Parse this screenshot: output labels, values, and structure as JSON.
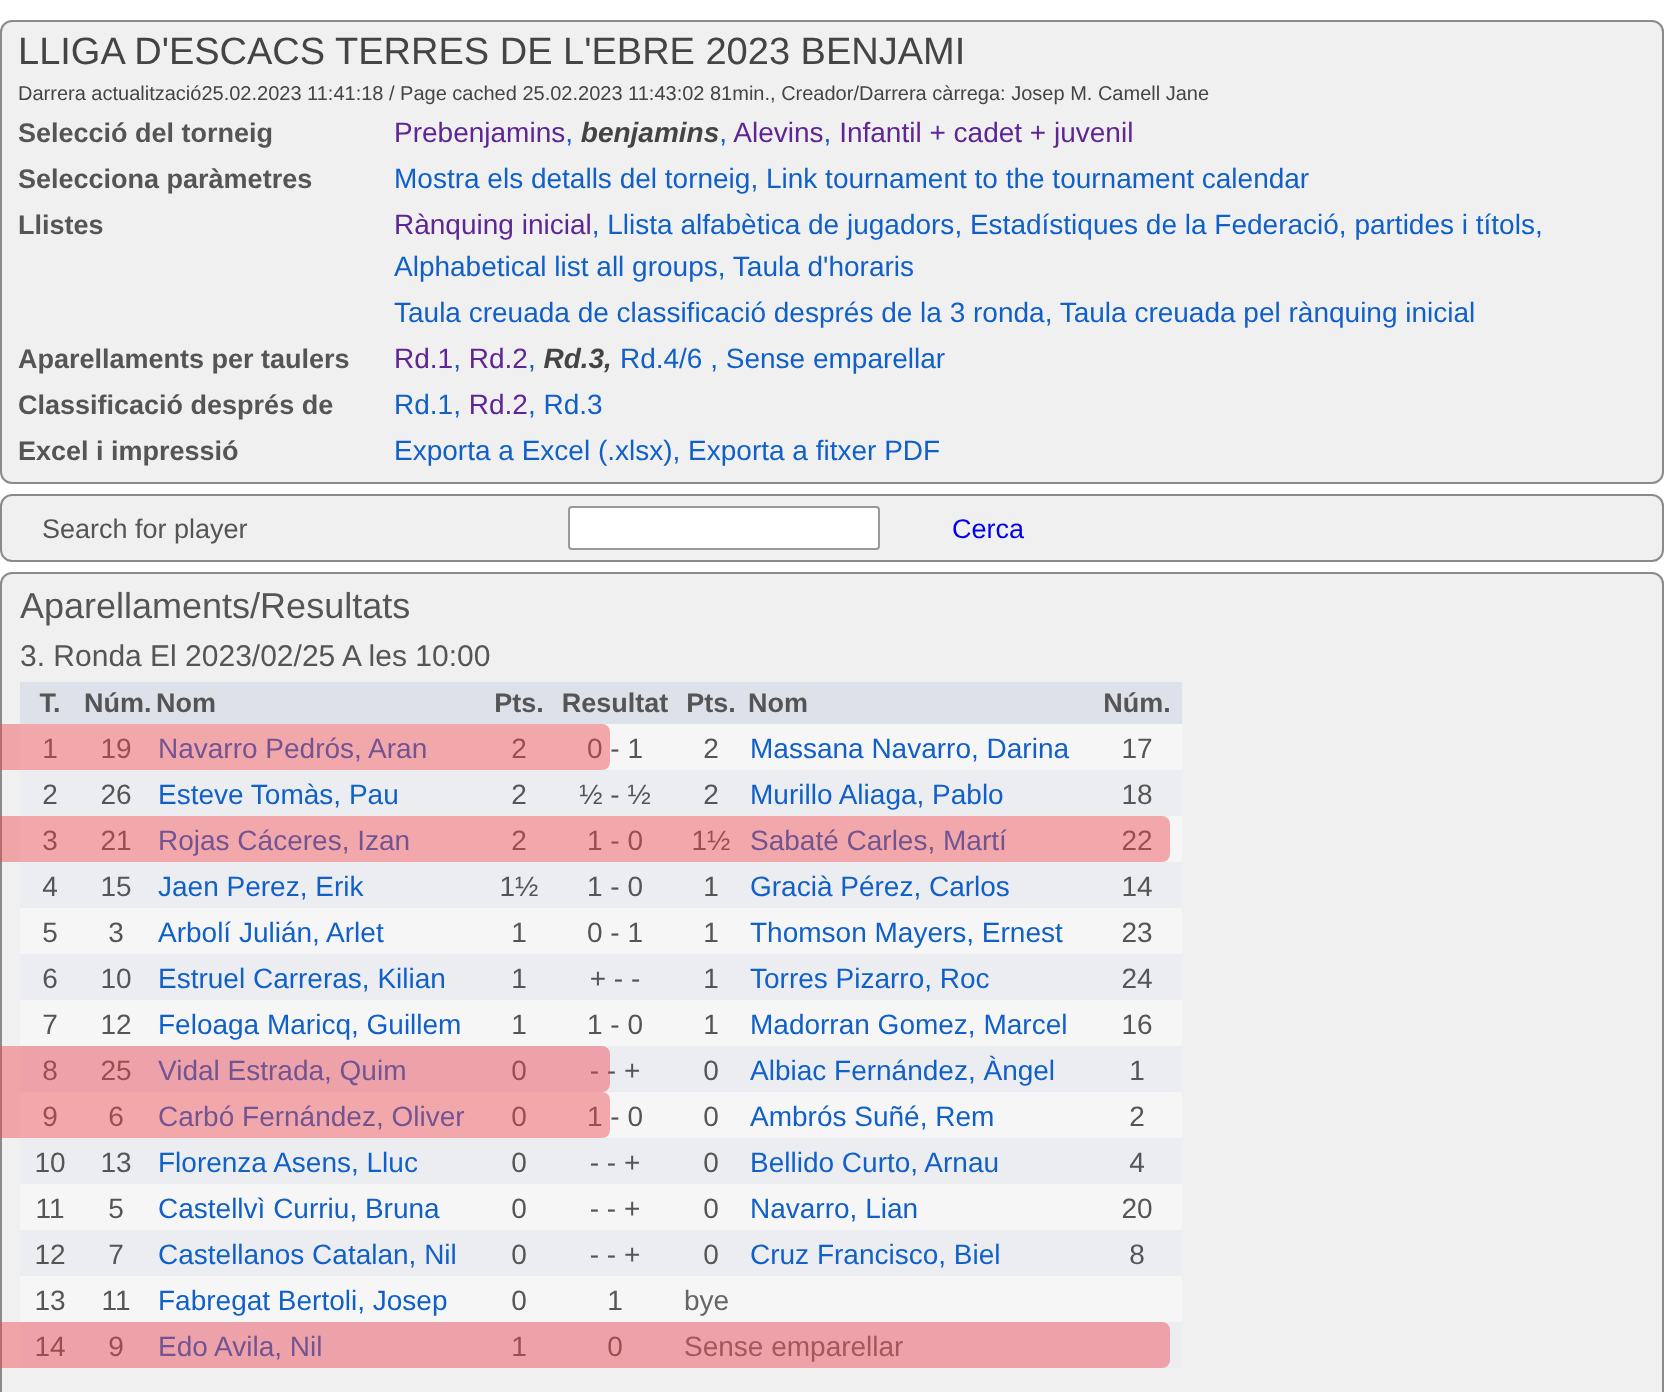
{
  "header": {
    "title": "LLIGA D'ESCACS TERRES DE L'EBRE 2023 BENJAMI",
    "meta": "Darrera actualització25.02.2023 11:41:18 / Page cached 25.02.2023 11:43:02 81min., Creador/Darrera càrrega: Josep M. Camell Jane",
    "rows": [
      {
        "label": "Selecció del torneig",
        "lines": [
          [
            {
              "text": "Prebenjamins",
              "visited": true,
              "current": false,
              "after": ", "
            },
            {
              "text": "benjamins",
              "visited": false,
              "current": true,
              "after": ", "
            },
            {
              "text": "Alevins",
              "visited": true,
              "current": false,
              "after": ", "
            },
            {
              "text": "Infantil + cadet + juvenil",
              "visited": true,
              "current": false
            }
          ]
        ]
      },
      {
        "label": "Selecciona paràmetres",
        "lines": [
          [
            {
              "text": "Mostra els detalls del torneig",
              "visited": false,
              "current": false,
              "after": ", "
            },
            {
              "text": "Link tournament to the tournament calendar",
              "visited": false,
              "current": false
            }
          ]
        ]
      },
      {
        "label": "Llistes",
        "lines": [
          [
            {
              "text": "Rànquing inicial",
              "visited": true,
              "current": false,
              "after": ", "
            },
            {
              "text": "Llista alfabètica de jugadors",
              "visited": false,
              "current": false,
              "after": ", "
            },
            {
              "text": "Estadístiques de la Federació, partides i títols",
              "visited": false,
              "current": false,
              "after": ", "
            },
            {
              "text": "Alphabetical list all groups",
              "visited": false,
              "current": false,
              "after": ", "
            },
            {
              "text": "Taula d'horaris",
              "visited": false,
              "current": false
            }
          ],
          [
            {
              "text": "Taula creuada de classificació després de la 3 ronda",
              "visited": false,
              "current": false,
              "after": ", "
            },
            {
              "text": "Taula creuada pel rànquing inicial",
              "visited": false,
              "current": false
            }
          ]
        ]
      },
      {
        "label": "Aparellaments per taulers",
        "lines": [
          [
            {
              "text": "Rd.1",
              "visited": true,
              "current": false,
              "after": ", "
            },
            {
              "text": "Rd.2",
              "visited": true,
              "current": false,
              "after": ", "
            },
            {
              "text": "Rd.3,",
              "visited": false,
              "current": true
            },
            {
              "text": "Rd.4/6",
              "visited": false,
              "current": false,
              "after": " , "
            },
            {
              "text": "Sense emparellar",
              "visited": false,
              "current": false
            }
          ]
        ]
      },
      {
        "label": "Classificació després de",
        "lines": [
          [
            {
              "text": "Rd.1",
              "visited": false,
              "current": false,
              "after": ", "
            },
            {
              "text": "Rd.2",
              "visited": true,
              "current": false,
              "after": ", "
            },
            {
              "text": "Rd.3",
              "visited": false,
              "current": false
            }
          ]
        ]
      },
      {
        "label": "Excel i impressió",
        "lines": [
          [
            {
              "text": "Exporta a Excel (.xlsx)",
              "visited": false,
              "current": false,
              "after": ", "
            },
            {
              "text": "Exporta a fitxer PDF",
              "visited": false,
              "current": false
            }
          ]
        ]
      }
    ]
  },
  "search": {
    "label": "Search for player",
    "button": "Cerca"
  },
  "results": {
    "title": "Aparellaments/Resultats",
    "round": "3. Ronda El 2023/02/25 A les 10:00",
    "columns": [
      "T.",
      "Núm.",
      "Nom",
      "Pts.",
      "Resultat",
      "Pts.",
      "Nom",
      "Núm."
    ],
    "rows": [
      {
        "board": "1",
        "num": "19",
        "name": "Navarro Pedrós, Aran",
        "pts": "2",
        "result": "0 - 1",
        "kind": "player",
        "pts2": "2",
        "name2": "Massana Navarro, Darina",
        "num2": "17",
        "highlighted": true,
        "highlight_wide": false
      },
      {
        "board": "2",
        "num": "26",
        "name": "Esteve Tomàs, Pau",
        "pts": "2",
        "result": "½ - ½",
        "kind": "player",
        "pts2": "2",
        "name2": "Murillo Aliaga, Pablo",
        "num2": "18",
        "highlighted": false
      },
      {
        "board": "3",
        "num": "21",
        "name": "Rojas Cáceres, Izan",
        "pts": "2",
        "result": "1 - 0",
        "kind": "player",
        "pts2": "1½",
        "name2": "Sabaté Carles, Martí",
        "num2": "22",
        "highlighted": true,
        "highlight_wide": true
      },
      {
        "board": "4",
        "num": "15",
        "name": "Jaen Perez, Erik",
        "pts": "1½",
        "result": "1 - 0",
        "kind": "player",
        "pts2": "1",
        "name2": "Gracià Pérez, Carlos",
        "num2": "14",
        "highlighted": false
      },
      {
        "board": "5",
        "num": "3",
        "name": "Arbolí Julián, Arlet",
        "pts": "1",
        "result": "0 - 1",
        "kind": "player",
        "pts2": "1",
        "name2": "Thomson Mayers, Ernest",
        "num2": "23",
        "highlighted": false
      },
      {
        "board": "6",
        "num": "10",
        "name": "Estruel Carreras, Kilian",
        "pts": "1",
        "result": "+ - -",
        "kind": "player",
        "pts2": "1",
        "name2": "Torres Pizarro, Roc",
        "num2": "24",
        "highlighted": false
      },
      {
        "board": "7",
        "num": "12",
        "name": "Feloaga Maricq, Guillem",
        "pts": "1",
        "result": "1 - 0",
        "kind": "player",
        "pts2": "1",
        "name2": "Madorran Gomez, Marcel",
        "num2": "16",
        "highlighted": false
      },
      {
        "board": "8",
        "num": "25",
        "name": "Vidal Estrada, Quim",
        "pts": "0",
        "result": "- - +",
        "kind": "player",
        "pts2": "0",
        "name2": "Albiac Fernández, Àngel",
        "num2": "1",
        "highlighted": true,
        "highlight_wide": false
      },
      {
        "board": "9",
        "num": "6",
        "name": "Carbó Fernández, Oliver",
        "pts": "0",
        "result": "1 - 0",
        "kind": "player",
        "pts2": "0",
        "name2": "Ambrós Suñé, Rem",
        "num2": "2",
        "highlighted": true,
        "highlight_wide": false
      },
      {
        "board": "10",
        "num": "13",
        "name": "Florenza Asens, Lluc",
        "pts": "0",
        "result": "- - +",
        "kind": "player",
        "pts2": "0",
        "name2": "Bellido Curto, Arnau",
        "num2": "4",
        "highlighted": false
      },
      {
        "board": "11",
        "num": "5",
        "name": "Castellvì Curriu, Bruna",
        "pts": "0",
        "result": "- - +",
        "kind": "player",
        "pts2": "0",
        "name2": "Navarro, Lian",
        "num2": "20",
        "highlighted": false
      },
      {
        "board": "12",
        "num": "7",
        "name": "Castellanos Catalan, Nil",
        "pts": "0",
        "result": "- - +",
        "kind": "player",
        "pts2": "0",
        "name2": "Cruz Francisco, Biel",
        "num2": "8",
        "highlighted": false
      },
      {
        "board": "13",
        "num": "11",
        "name": "Fabregat Bertoli, Josep",
        "pts": "0",
        "result": "1",
        "kind": "note",
        "name2": "bye",
        "highlighted": false
      },
      {
        "board": "14",
        "num": "9",
        "name": "Edo Avila, Nil",
        "pts": "1",
        "result": "0",
        "kind": "note",
        "name2": "Sense emparellar",
        "highlighted": true,
        "highlight_wide": true
      }
    ]
  }
}
